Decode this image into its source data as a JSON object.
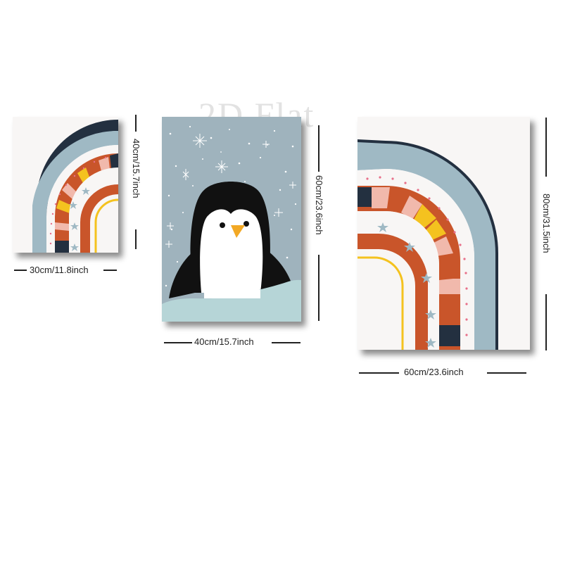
{
  "watermark": "2D Flat",
  "colors": {
    "background": "#ffffff",
    "rainbow_blue": "#9fb9c4",
    "rainbow_navy": "#233040",
    "rainbow_orange": "#c9552a",
    "rainbow_yellow": "#f4c21f",
    "rainbow_pink": "#f1b9ac",
    "penguin_bg": "#9fb3bd",
    "snow_ground": "#b6d5d7"
  },
  "posters": [
    {
      "name": "small-rainbow-poster",
      "width_label": "30cm/11.8inch",
      "height_label": "40cm/15.7inch"
    },
    {
      "name": "penguin-poster",
      "width_label": "40cm/15.7inch",
      "height_label": "60cm/23.6inch"
    },
    {
      "name": "large-rainbow-poster",
      "width_label": "60cm/23.6inch",
      "height_label": "80cm/31.5inch"
    }
  ]
}
